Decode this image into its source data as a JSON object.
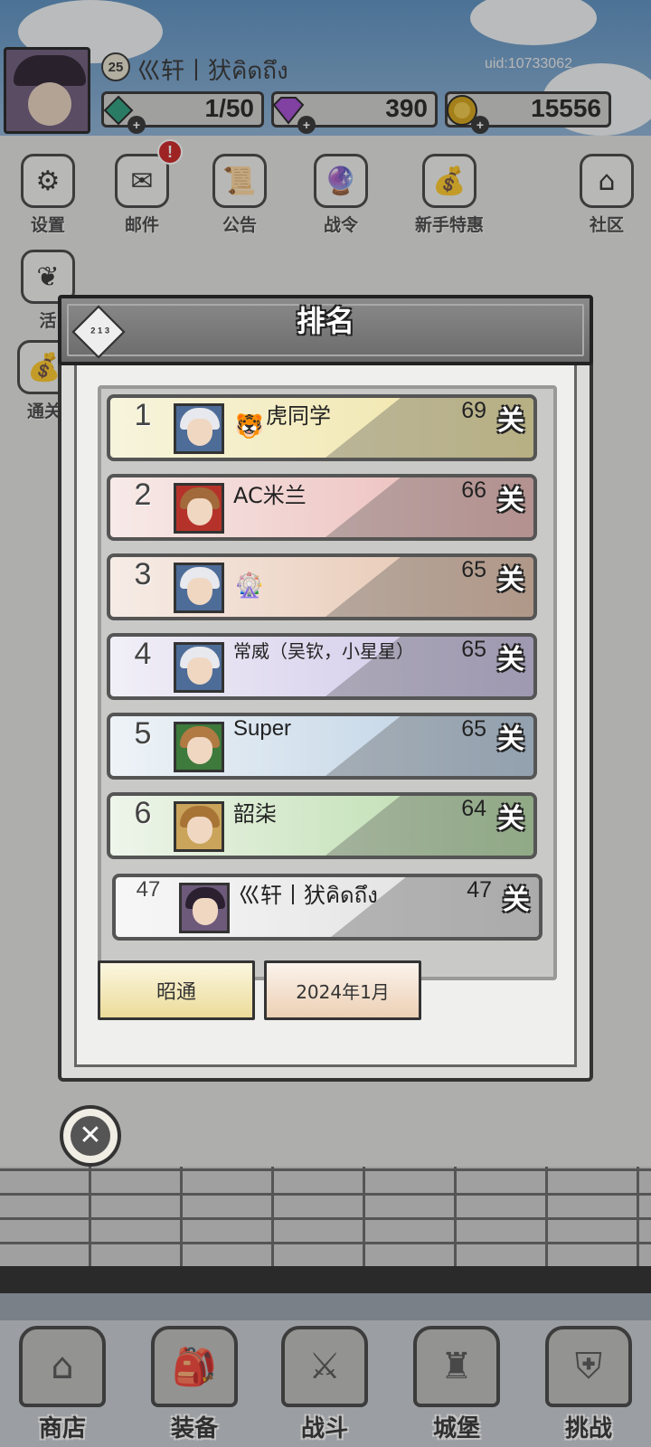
{
  "header": {
    "level": "25",
    "player_name": "巛轩丨犾คิดถึง",
    "uid": "uid:10733062",
    "resources": [
      {
        "icon": "energy-gem-icon",
        "value": "1/50"
      },
      {
        "icon": "diamond-icon",
        "value": "390"
      },
      {
        "icon": "gold-coin-icon",
        "value": "15556"
      }
    ]
  },
  "menu": [
    {
      "icon": "gear-icon",
      "label": "设置"
    },
    {
      "icon": "mail-icon",
      "label": "邮件",
      "alert": "!"
    },
    {
      "icon": "scroll-icon",
      "label": "公告"
    },
    {
      "icon": "crystal-ball-icon",
      "label": "战令"
    },
    {
      "icon": "loot-bag-icon",
      "label": "新手特惠"
    },
    {
      "icon": "home-icon",
      "label": "社区"
    }
  ],
  "side_labels": [
    "活",
    "通关"
  ],
  "ranking": {
    "title": "排名",
    "unit": "关",
    "rows": [
      {
        "rank": "1",
        "name": "虎同学",
        "emoji": "🐯",
        "score": "69"
      },
      {
        "rank": "2",
        "name": "AC米兰",
        "score": "66"
      },
      {
        "rank": "3",
        "name": "",
        "emoji": "🎡",
        "score": "65"
      },
      {
        "rank": "4",
        "name": "常威（吴钦，小星星）",
        "score": "65"
      },
      {
        "rank": "5",
        "name": "Super",
        "score": "65"
      },
      {
        "rank": "6",
        "name": "韶柒",
        "score": "64"
      }
    ],
    "me": {
      "rank": "47",
      "name": "巛轩丨犾คิดถึง",
      "score": "47"
    },
    "filters": {
      "region": "昭通",
      "month": "2024年1月"
    }
  },
  "bottom_nav": [
    {
      "icon": "shop-hut-icon",
      "label": "商店"
    },
    {
      "icon": "backpack-icon",
      "label": "装备"
    },
    {
      "icon": "crossed-swords-icon",
      "label": "战斗"
    },
    {
      "icon": "castle-icon",
      "label": "城堡"
    },
    {
      "icon": "shield-icon",
      "label": "挑战"
    }
  ],
  "colors": {
    "rank1": "#efe3a0",
    "rank2": "#e9b4b2",
    "rank3": "#e4bfa7",
    "rank4": "#c9c0e6",
    "rank5": "#b7cde2",
    "rank6": "#b3d9a3"
  }
}
